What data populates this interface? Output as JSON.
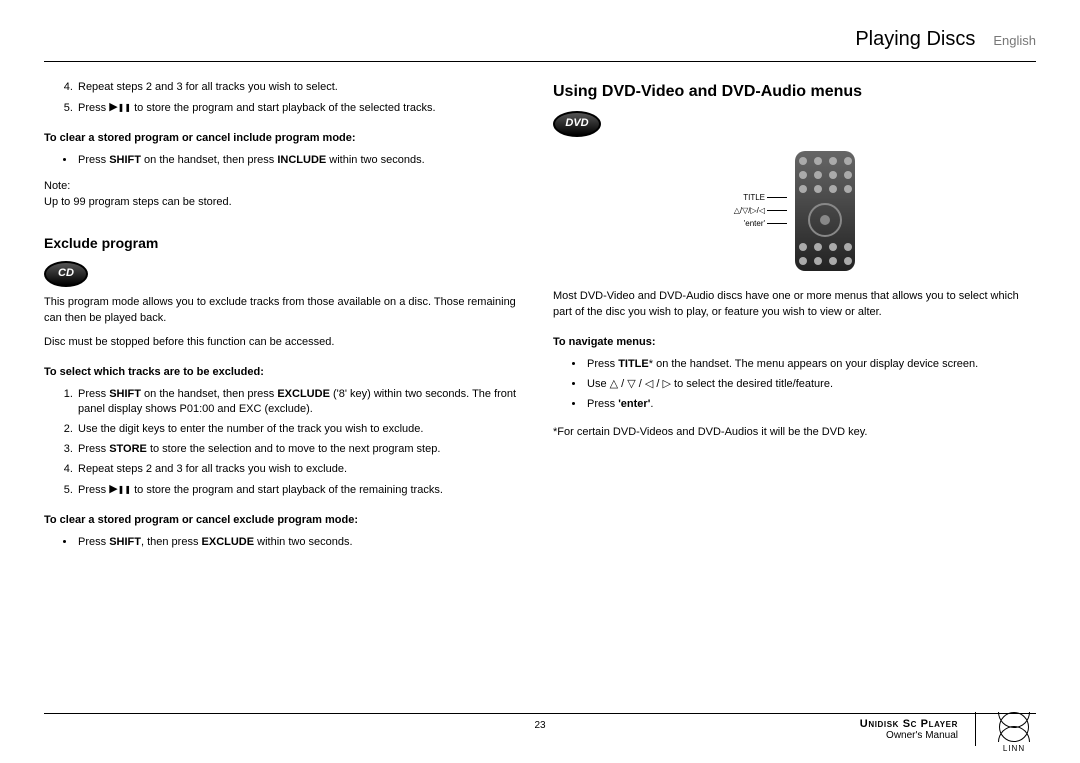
{
  "header": {
    "title": "Playing Discs",
    "language": "English"
  },
  "left": {
    "steps_cont": [
      {
        "n": "4.",
        "text": "Repeat steps 2 and 3 for all tracks you wish to select."
      },
      {
        "n": "5.",
        "pre": "Press ",
        "post": " to store the program and start playback of the selected tracks."
      }
    ],
    "clear_include_h": "To clear a stored program or cancel include program mode:",
    "clear_include_item_pre": "Press ",
    "clear_include_item_b1": "SHIFT",
    "clear_include_item_mid": " on the handset, then press ",
    "clear_include_item_b2": "INCLUDE",
    "clear_include_item_post": " within two seconds.",
    "note_label": "Note:",
    "note_text": "Up to 99 program steps can be stored.",
    "exclude_h": "Exclude program",
    "cd_badge": "CD",
    "exclude_p1": "This program mode allows you to exclude tracks from those available on a disc. Those remaining can then be played back.",
    "exclude_p2": "Disc must be stopped before this function can be accessed.",
    "select_h": "To select which tracks are to be excluded:",
    "select_steps": {
      "s1_pre": "Press ",
      "s1_b1": "SHIFT",
      "s1_mid": " on the handset, then press ",
      "s1_b2": "EXCLUDE",
      "s1_post": " ('8' key) within two seconds. The front panel display shows P01:00 and EXC (exclude).",
      "s2": "Use the digit keys to enter the number of the track you wish to exclude.",
      "s3_pre": "Press ",
      "s3_b": "STORE",
      "s3_post": " to store the selection and to move to the next program step.",
      "s4": "Repeat steps 2 and 3 for all tracks you wish to exclude.",
      "s5_pre": "Press ",
      "s5_post": " to store the program and start playback of the remaining tracks."
    },
    "clear_exclude_h": "To clear a stored program or cancel exclude program mode:",
    "clear_exclude_pre": "Press ",
    "clear_exclude_b1": "SHIFT",
    "clear_exclude_mid": ", then press ",
    "clear_exclude_b2": "EXCLUDE",
    "clear_exclude_post": " within two seconds."
  },
  "right": {
    "h": "Using DVD-Video and DVD-Audio menus",
    "dvd_badge": "DVD",
    "remote_labels": {
      "l1": "TITLE",
      "l2": "△/▽/▷/◁",
      "l3": "'enter'"
    },
    "intro": "Most DVD-Video and DVD-Audio discs have one or more menus that allows you to select which part of the disc you wish to play, or feature you wish to view or alter.",
    "nav_h": "To navigate menus:",
    "nav1_pre": "Press ",
    "nav1_b": "TITLE",
    "nav1_post": "* on the handset. The menu appears on your display device screen.",
    "nav2_pre": "Use  ",
    "nav2_sym": "△ / ▽ / ◁ / ▷",
    "nav2_post": "  to select the desired title/feature.",
    "nav3_pre": "Press ",
    "nav3_b": "'enter'",
    "nav3_post": ".",
    "footnote": "*For certain DVD-Videos and DVD-Audios it will be the DVD key."
  },
  "footer": {
    "page": "23",
    "product": "Unidisk Sc Player",
    "subtitle": "Owner's Manual",
    "brand": "LINN"
  }
}
